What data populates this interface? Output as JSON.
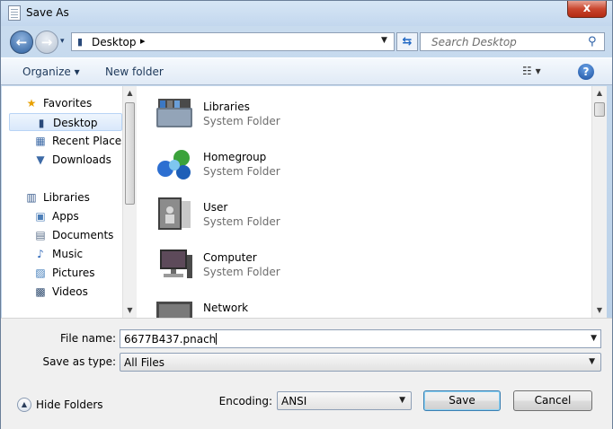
{
  "window": {
    "title": "Save As",
    "close_glyph": "x"
  },
  "navbar": {
    "back_glyph": "←",
    "forward_glyph": "→",
    "address": {
      "location": "Desktop",
      "chevron": "▸"
    },
    "search_placeholder": "Search Desktop",
    "refresh_glyph": "⇆"
  },
  "toolbar": {
    "organize_label": "Organize",
    "new_folder_label": "New folder",
    "view_glyph": "☷ ▾",
    "help_glyph": "?"
  },
  "nav_pane": {
    "favorites": {
      "label": "Favorites",
      "icon": "star-icon",
      "items": [
        {
          "label": "Desktop",
          "icon": "desktop-icon",
          "selected": true
        },
        {
          "label": "Recent Places",
          "icon": "recent-places-icon",
          "selected": false
        },
        {
          "label": "Downloads",
          "icon": "downloads-icon",
          "selected": false
        }
      ]
    },
    "libraries": {
      "label": "Libraries",
      "icon": "libraries-icon",
      "items": [
        {
          "label": "Apps",
          "icon": "apps-icon"
        },
        {
          "label": "Documents",
          "icon": "documents-icon"
        },
        {
          "label": "Music",
          "icon": "music-icon"
        },
        {
          "label": "Pictures",
          "icon": "pictures-icon"
        },
        {
          "label": "Videos",
          "icon": "videos-icon"
        }
      ]
    }
  },
  "content": {
    "items": [
      {
        "name": "Libraries",
        "type": "System Folder",
        "icon": "libraries-folder-icon"
      },
      {
        "name": "Homegroup",
        "type": "System Folder",
        "icon": "homegroup-icon"
      },
      {
        "name": "User",
        "type": "System Folder",
        "icon": "user-folder-icon"
      },
      {
        "name": "Computer",
        "type": "System Folder",
        "icon": "computer-icon"
      },
      {
        "name": "Network",
        "type": "",
        "icon": "network-icon"
      }
    ]
  },
  "save_form": {
    "file_name_label": "File name:",
    "file_name_value": "6677B437.pnach",
    "save_as_type_label": "Save as type:",
    "save_as_type_value": "All Files",
    "encoding_label": "Encoding:",
    "encoding_value": "ANSI",
    "save_button": "Save",
    "cancel_button": "Cancel",
    "hide_folders_label": "Hide Folders",
    "hide_folders_glyph": "▲"
  },
  "colors": {
    "accent": "#1e395b",
    "selection": "#d9e8fb",
    "close": "#c9462e"
  }
}
